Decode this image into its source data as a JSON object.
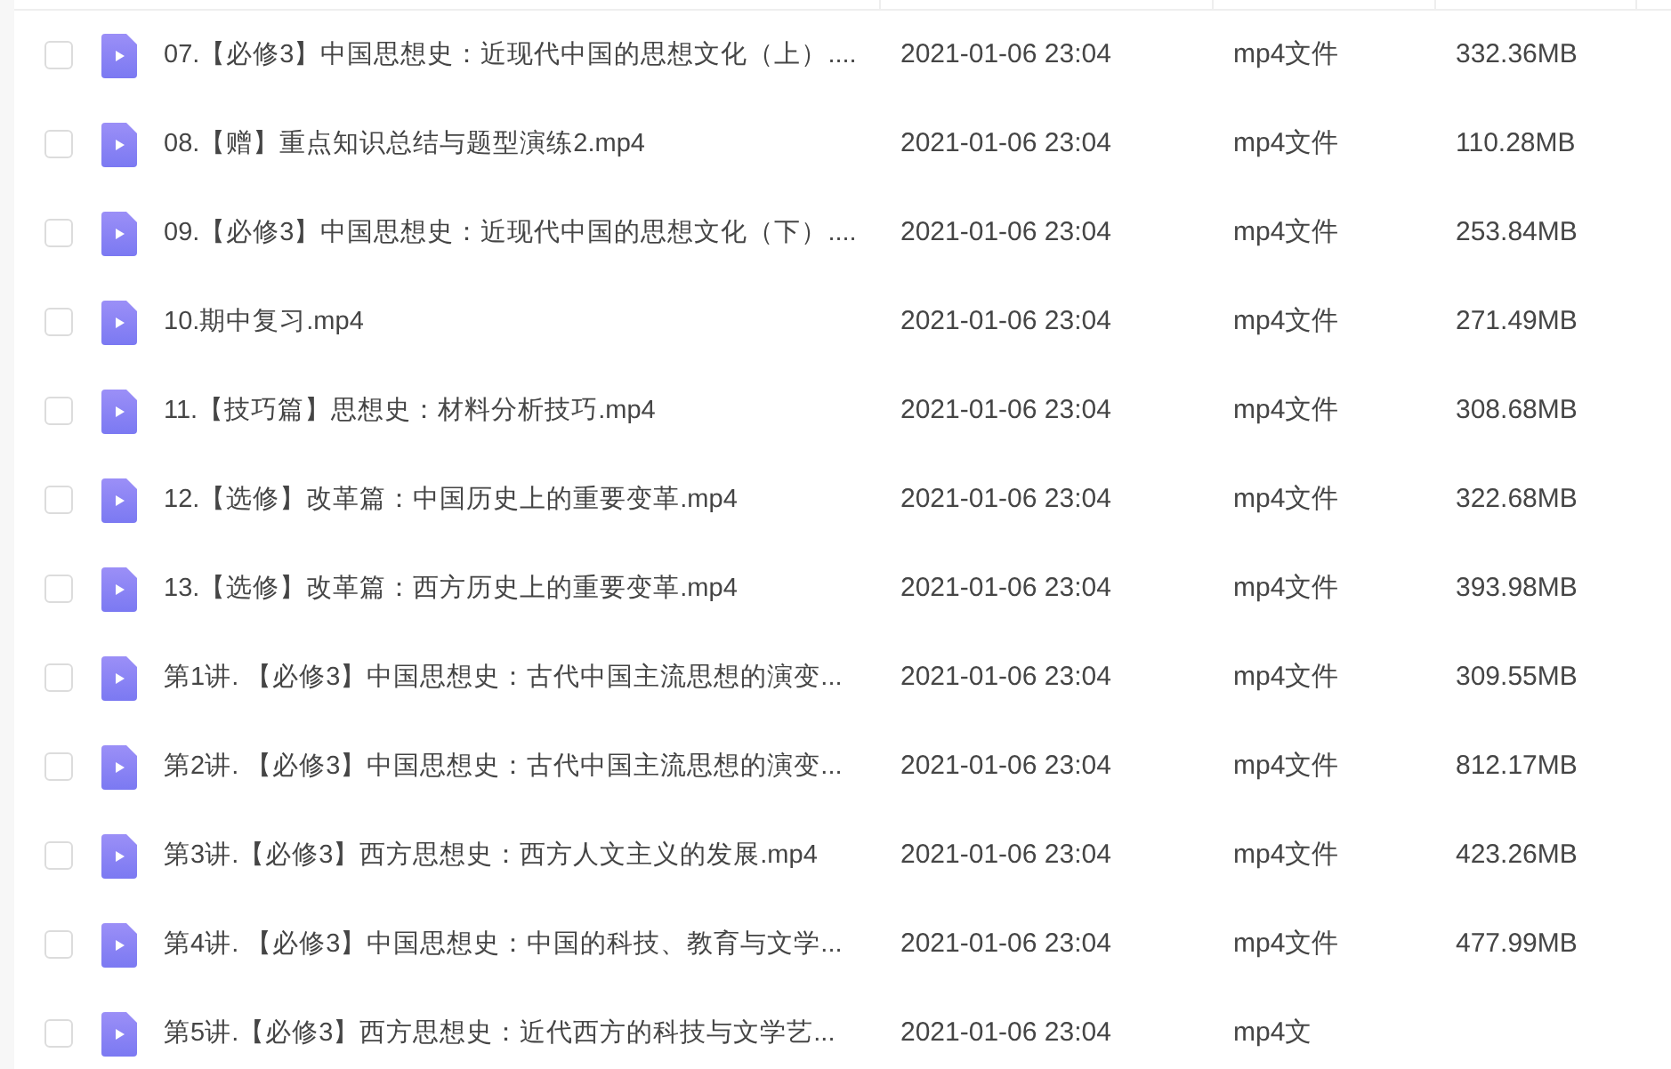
{
  "files": [
    {
      "name": "07.【必修3】中国思想史：近现代中国的思想文化（上）....",
      "modified": "2021-01-06 23:04",
      "type": "mp4文件",
      "size": "332.36MB",
      "checked": false
    },
    {
      "name": "08.【赠】重点知识总结与题型演练2.mp4",
      "modified": "2021-01-06 23:04",
      "type": "mp4文件",
      "size": "110.28MB",
      "checked": false
    },
    {
      "name": "09.【必修3】中国思想史：近现代中国的思想文化（下）....",
      "modified": "2021-01-06 23:04",
      "type": "mp4文件",
      "size": "253.84MB",
      "checked": false
    },
    {
      "name": "10.期中复习.mp4",
      "modified": "2021-01-06 23:04",
      "type": "mp4文件",
      "size": "271.49MB",
      "checked": false
    },
    {
      "name": "11.【技巧篇】思想史：材料分析技巧.mp4",
      "modified": "2021-01-06 23:04",
      "type": "mp4文件",
      "size": "308.68MB",
      "checked": false
    },
    {
      "name": "12.【选修】改革篇：中国历史上的重要变革.mp4",
      "modified": "2021-01-06 23:04",
      "type": "mp4文件",
      "size": "322.68MB",
      "checked": false
    },
    {
      "name": "13.【选修】改革篇：西方历史上的重要变革.mp4",
      "modified": "2021-01-06 23:04",
      "type": "mp4文件",
      "size": "393.98MB",
      "checked": false
    },
    {
      "name": "第1讲. 【必修3】中国思想史：古代中国主流思想的演变...",
      "modified": "2021-01-06 23:04",
      "type": "mp4文件",
      "size": "309.55MB",
      "checked": false
    },
    {
      "name": "第2讲. 【必修3】中国思想史：古代中国主流思想的演变...",
      "modified": "2021-01-06 23:04",
      "type": "mp4文件",
      "size": "812.17MB",
      "checked": false
    },
    {
      "name": "第3讲.【必修3】西方思想史：西方人文主义的发展.mp4",
      "modified": "2021-01-06 23:04",
      "type": "mp4文件",
      "size": "423.26MB",
      "checked": false
    },
    {
      "name": "第4讲. 【必修3】中国思想史：中国的科技、教育与文学...",
      "modified": "2021-01-06 23:04",
      "type": "mp4文件",
      "size": "477.99MB",
      "checked": false
    },
    {
      "name": "第5讲.【必修3】西方思想史：近代西方的科技与文学艺...",
      "modified": "2021-01-06 23:04",
      "type": "mp4文",
      "checked": false
    }
  ]
}
